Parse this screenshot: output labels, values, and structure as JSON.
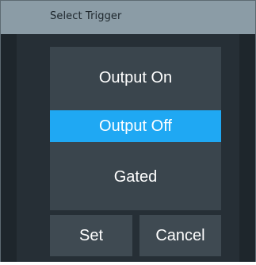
{
  "dialog": {
    "title": "Select Trigger"
  },
  "options": [
    {
      "label": "Output On",
      "selected": false
    },
    {
      "label": "Output Off",
      "selected": true
    },
    {
      "label": "Gated",
      "selected": false
    }
  ],
  "buttons": {
    "set_label": "Set",
    "cancel_label": "Cancel"
  },
  "colors": {
    "titlebar": "#8b9ca6",
    "background": "#262f36",
    "list_background": "#3a454d",
    "selected": "#1fa8f3",
    "button": "#3f4a52",
    "text": "#ffffff"
  }
}
